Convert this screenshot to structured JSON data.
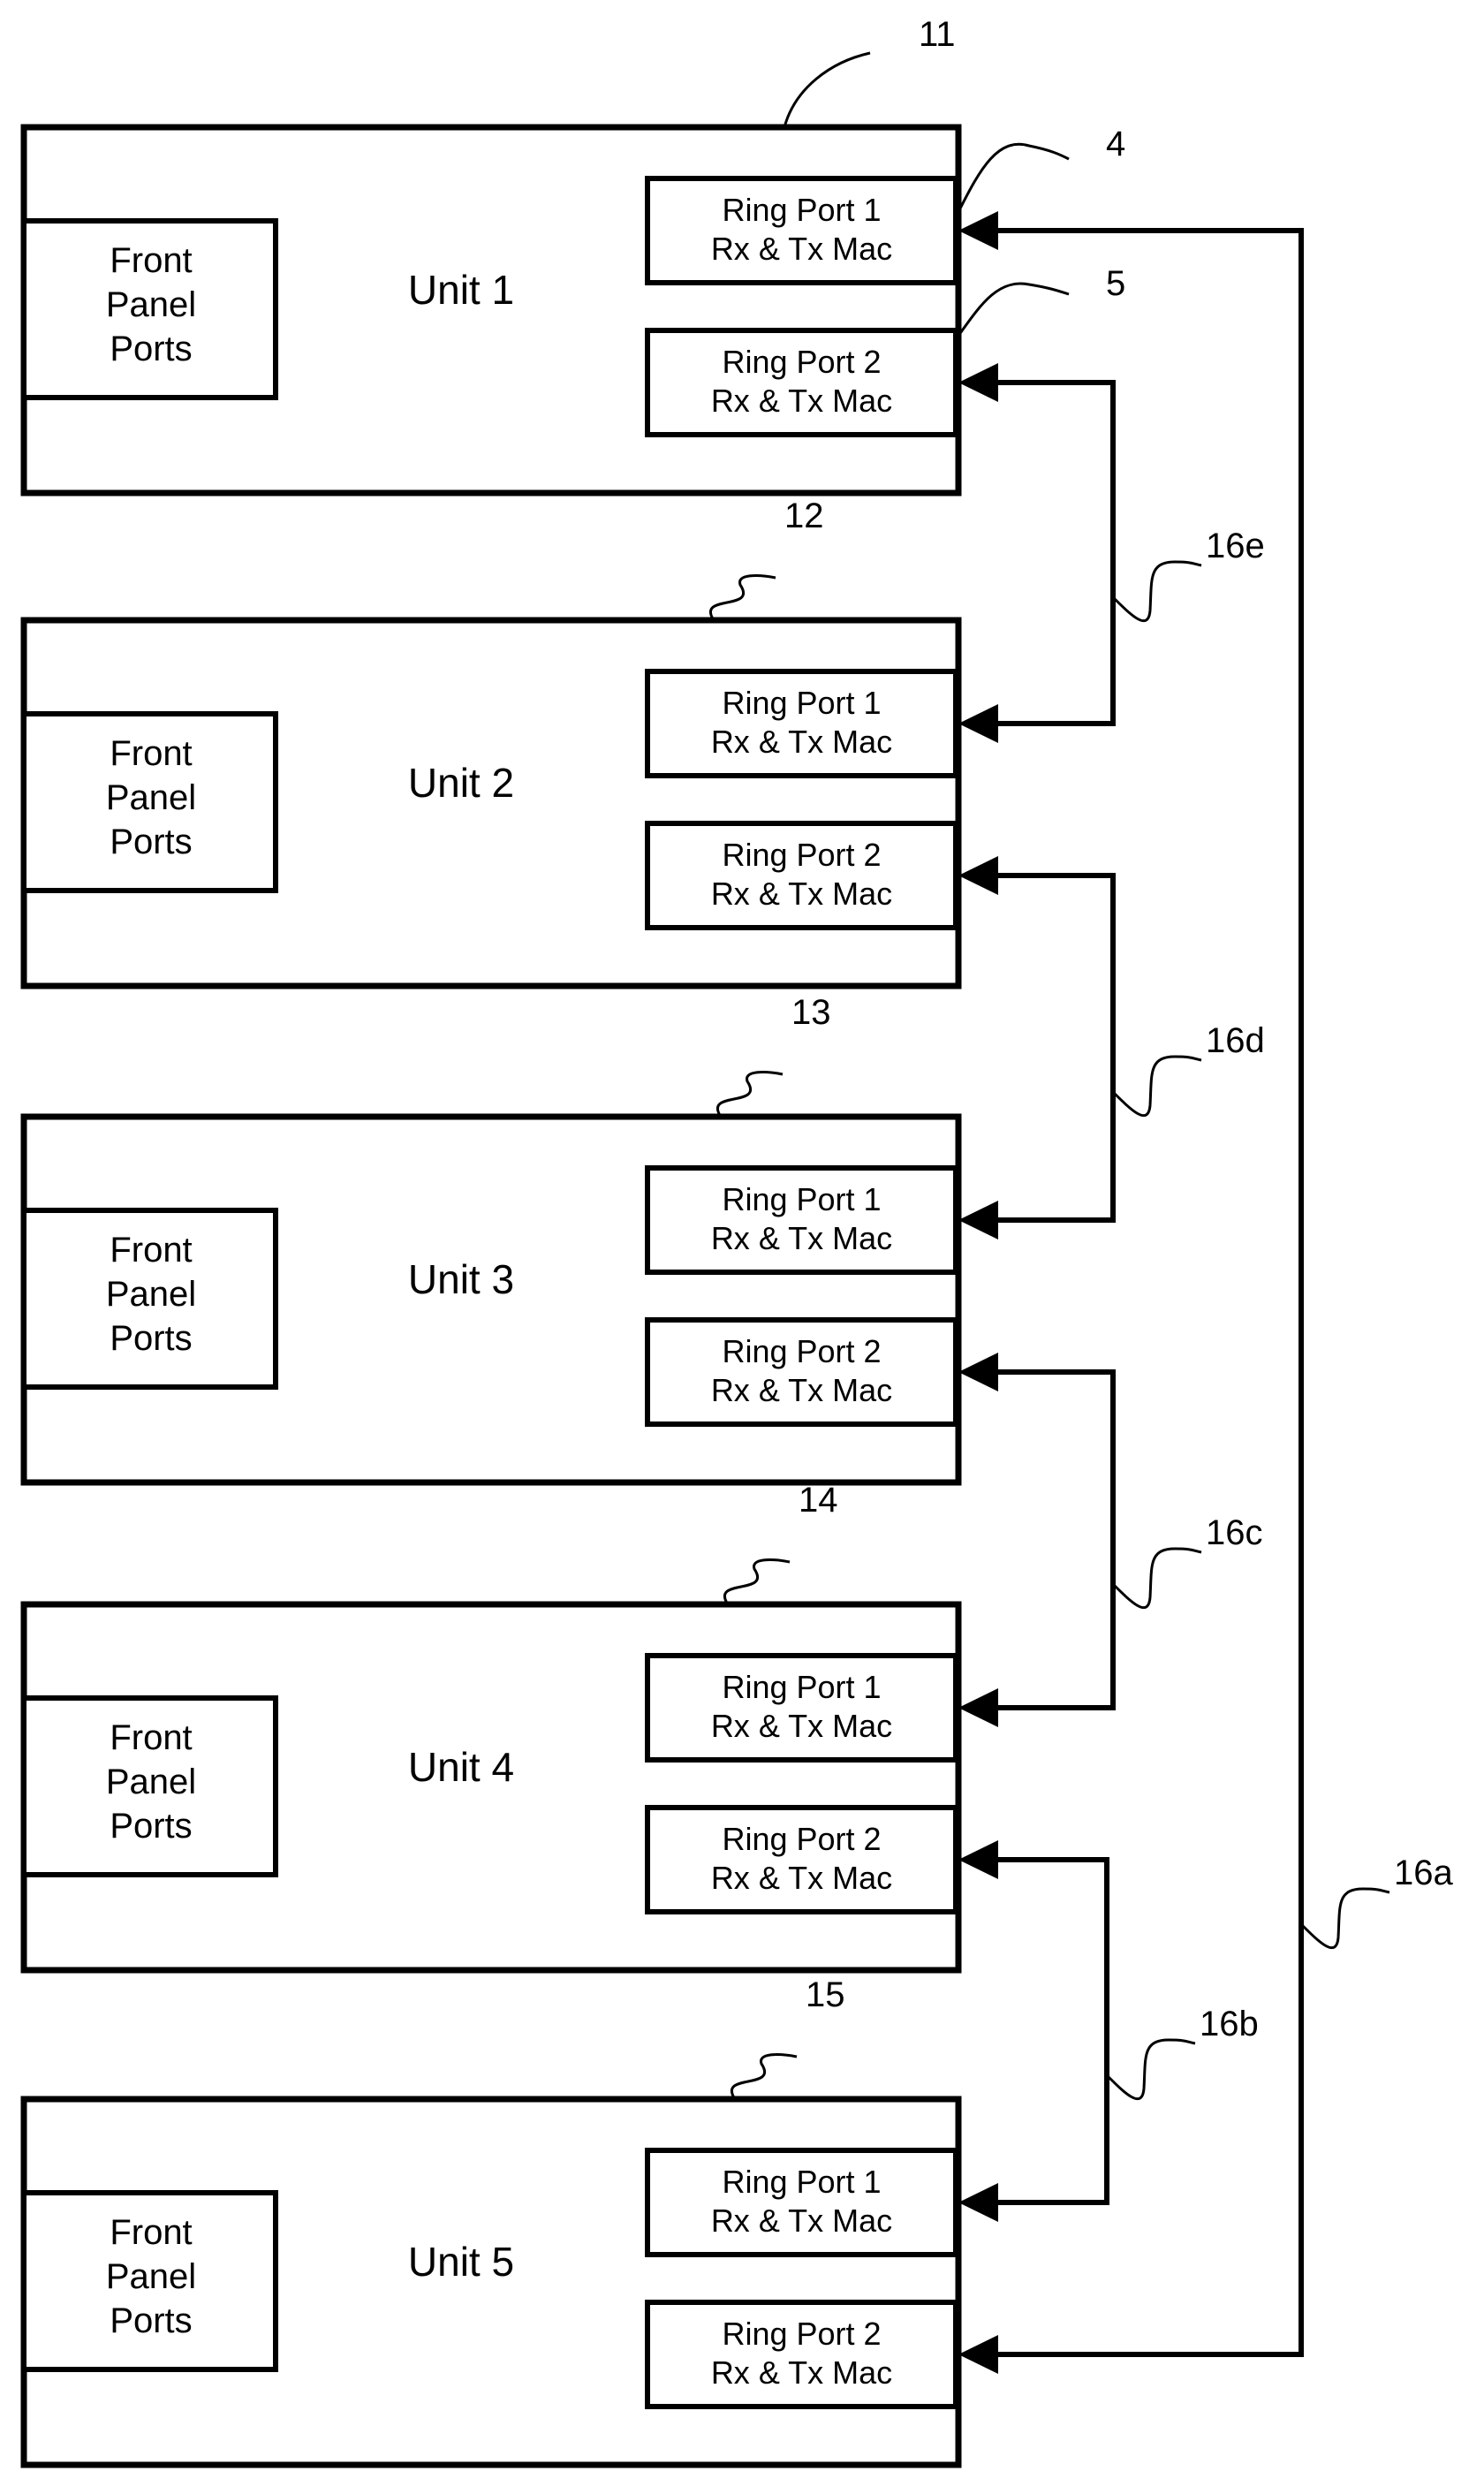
{
  "diagram": {
    "units": [
      {
        "name": "Unit 1",
        "ref": "11",
        "front_panel": [
          "Front",
          "Panel",
          "Ports"
        ],
        "port1": [
          "Ring Port 1",
          "Rx & Tx Mac"
        ],
        "port2": [
          "Ring Port 2",
          "Rx & Tx Mac"
        ]
      },
      {
        "name": "Unit 2",
        "ref": "12",
        "front_panel": [
          "Front",
          "Panel",
          "Ports"
        ],
        "port1": [
          "Ring Port 1",
          "Rx & Tx Mac"
        ],
        "port2": [
          "Ring Port 2",
          "Rx & Tx Mac"
        ]
      },
      {
        "name": "Unit 3",
        "ref": "13",
        "front_panel": [
          "Front",
          "Panel",
          "Ports"
        ],
        "port1": [
          "Ring Port 1",
          "Rx & Tx Mac"
        ],
        "port2": [
          "Ring Port 2",
          "Rx & Tx Mac"
        ]
      },
      {
        "name": "Unit 4",
        "ref": "14",
        "front_panel": [
          "Front",
          "Panel",
          "Ports"
        ],
        "port1": [
          "Ring Port 1",
          "Rx & Tx Mac"
        ],
        "port2": [
          "Ring Port 2",
          "Rx & Tx Mac"
        ]
      },
      {
        "name": "Unit 5",
        "ref": "15",
        "front_panel": [
          "Front",
          "Panel",
          "Ports"
        ],
        "port1": [
          "Ring Port 1",
          "Rx & Tx Mac"
        ],
        "port2": [
          "Ring Port 2",
          "Rx & Tx Mac"
        ]
      }
    ],
    "port_refs": {
      "port1": "4",
      "port2": "5"
    },
    "links": [
      {
        "ref": "16e",
        "from": "Unit 1 Ring Port 2",
        "to": "Unit 2 Ring Port 1"
      },
      {
        "ref": "16d",
        "from": "Unit 2 Ring Port 2",
        "to": "Unit 3 Ring Port 1"
      },
      {
        "ref": "16c",
        "from": "Unit 3 Ring Port 2",
        "to": "Unit 4 Ring Port 1"
      },
      {
        "ref": "16b",
        "from": "Unit 4 Ring Port 2",
        "to": "Unit 5 Ring Port 1"
      },
      {
        "ref": "16a",
        "from": "Unit 5 Ring Port 2",
        "to": "Unit 1 Ring Port 1"
      }
    ]
  }
}
